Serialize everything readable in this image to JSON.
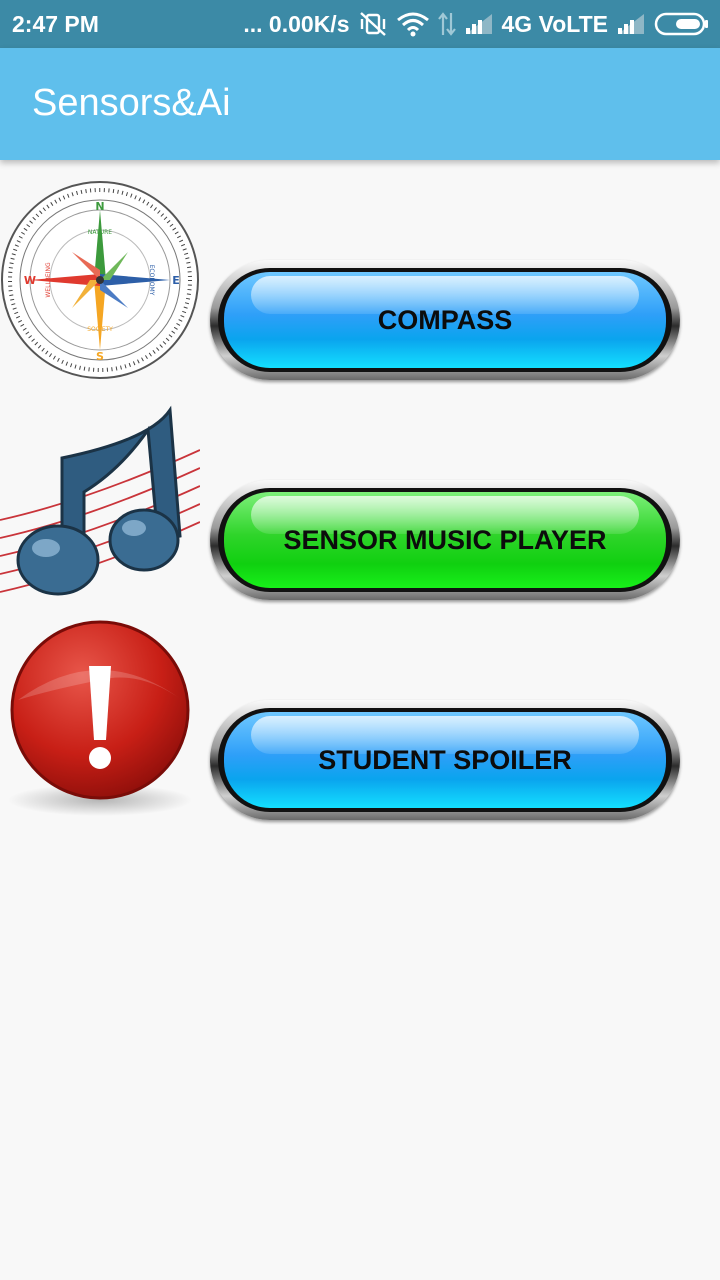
{
  "status_bar": {
    "time": "2:47 PM",
    "network_speed": "... 0.00K/s",
    "network_label": "4G VoLTE",
    "icons": [
      "vibrate-off-icon",
      "wifi-icon",
      "data-arrows-icon",
      "signal-icon",
      "signal-icon",
      "battery-icon"
    ]
  },
  "app_bar": {
    "title": "Sensors&Ai",
    "color": "#5fbfec"
  },
  "menu": [
    {
      "label": "COMPASS",
      "icon": "compass-icon",
      "color": "blue"
    },
    {
      "label": "SENSOR MUSIC PLAYER",
      "icon": "music-note-icon",
      "color": "green"
    },
    {
      "label": "STUDENT SPOILER",
      "icon": "exclamation-icon",
      "color": "blue"
    }
  ],
  "compass_labels": {
    "north": "N",
    "south": "S",
    "east": "E",
    "west": "W",
    "top_ring": "NATURE",
    "right_ring": "ECONOMY",
    "bottom_ring": "SOCIETY",
    "left_ring": "WELLBEING"
  },
  "colors": {
    "status_bar": "#3c8aa6",
    "background": "#f8f8f8"
  }
}
